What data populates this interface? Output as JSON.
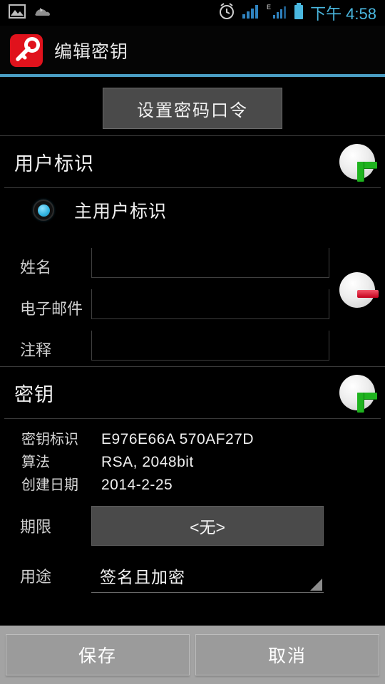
{
  "statusbar": {
    "icons": [
      "image-icon",
      "sync-icon",
      "alarm-clock-icon",
      "signal-bars-icon",
      "edge-data-icon",
      "battery-icon"
    ],
    "time": "下午 4:58",
    "time_color": "#4ab8e0"
  },
  "actionbar": {
    "app_icon": "key-icon",
    "title": "编辑密钥",
    "accent_color": "#4a9ec4",
    "icon_bg": "#e0121c"
  },
  "passphrase": {
    "button_label": "设置密码口令"
  },
  "userid_section": {
    "title": "用户标识",
    "add_icon": "plus-icon",
    "add_color": "#1fb31f",
    "primary": {
      "radio_label": "主用户标识",
      "selected": true,
      "radio_color": "#2fb3e0"
    },
    "fields": [
      {
        "label": "姓名",
        "value": "",
        "placeholder": ""
      },
      {
        "label": "电子邮件",
        "value": "",
        "placeholder": ""
      },
      {
        "label": "注释",
        "value": "",
        "placeholder": ""
      }
    ],
    "remove_icon": "minus-icon",
    "remove_color": "#c4001c"
  },
  "key_section": {
    "title": "密钥",
    "add_icon": "plus-icon",
    "details": [
      {
        "key": "密钥标识",
        "value": "E976E66A  570AF27D"
      },
      {
        "key": "算法",
        "value": "RSA, 2048bit"
      },
      {
        "key": "创建日期",
        "value": "2014-2-25"
      }
    ],
    "expiry": {
      "label": "期限",
      "value": "<无>"
    },
    "usage": {
      "label": "用途",
      "value": "签名且加密",
      "caret_icon": "dropdown-caret-icon"
    }
  },
  "bottombar": {
    "save_label": "保存",
    "cancel_label": "取消"
  }
}
